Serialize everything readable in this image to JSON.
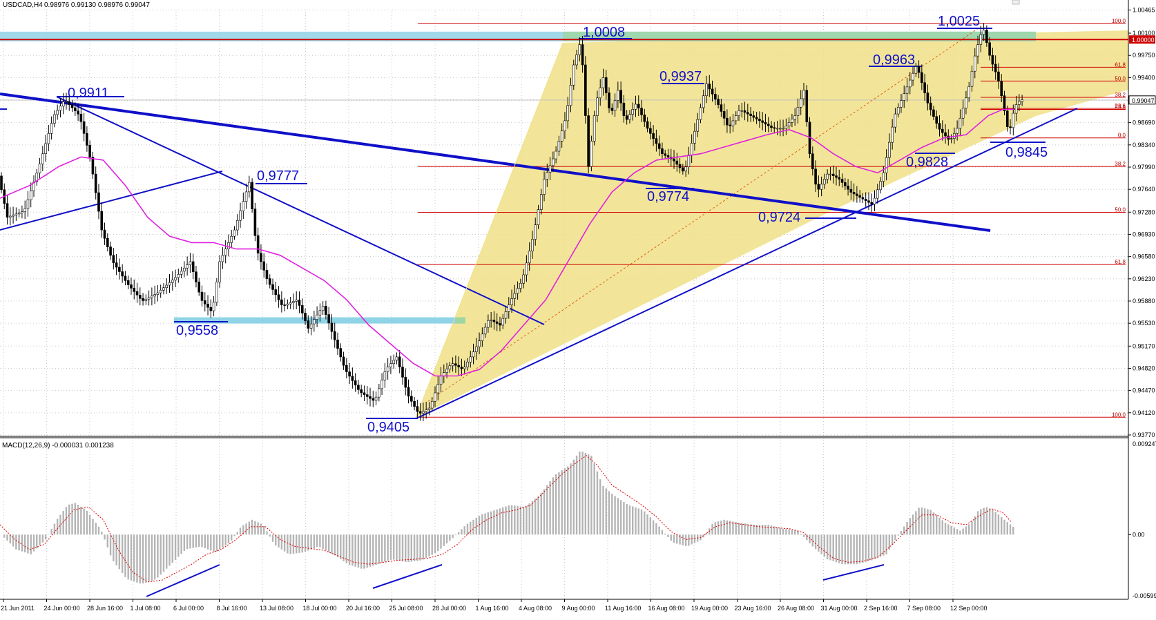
{
  "header": {
    "symbol": "USDCAD,H4",
    "ohlc": "0.98976 0.99130 0.98976 0.99047",
    "macd": "MACD(12,26,9) -0.000031 0.001238"
  },
  "chart_data": {
    "type": "candlestick",
    "title": "USDCAD,H4",
    "ylim": [
      0.9377,
      1.0047
    ],
    "price_ticks": [
      "1.00465",
      "1.00100",
      "0.99750",
      "0.99400",
      "0.99040",
      "0.98690",
      "0.98340",
      "0.97990",
      "0.97640",
      "0.97280",
      "0.96930",
      "0.96580",
      "0.96230",
      "0.95880",
      "0.95530",
      "0.95170",
      "0.94820",
      "0.94470",
      "0.94120",
      "0.93770"
    ],
    "price_label_current": "0.99047",
    "price_label_level": "1.00000",
    "time_labels": [
      "21 Jun 2011",
      "24 Jun 00:00",
      "28 Jun 16:00",
      "1 Jul 08:00",
      "6 Jul 00:00",
      "8 Jul 16:00",
      "13 Jul 08:00",
      "18 Jul 00:00",
      "20 Jul 16:00",
      "25 Jul 08:00",
      "28 Jul 00:00",
      "1 Aug 16:00",
      "4 Aug 08:00",
      "9 Aug 00:00",
      "11 Aug 16:00",
      "16 Aug 08:00",
      "19 Aug 00:00",
      "23 Aug 16:00",
      "26 Aug 08:00",
      "31 Aug 00:00",
      "2 Sep 16:00",
      "7 Sep 08:00",
      "12 Sep 00:00"
    ],
    "price_path": [
      [
        0,
        0.9785
      ],
      [
        12,
        0.972
      ],
      [
        35,
        0.973
      ],
      [
        55,
        0.98
      ],
      [
        75,
        0.988
      ],
      [
        90,
        0.9905
      ],
      [
        110,
        0.988
      ],
      [
        125,
        0.981
      ],
      [
        140,
        0.97
      ],
      [
        155,
        0.965
      ],
      [
        175,
        0.9615
      ],
      [
        195,
        0.9588
      ],
      [
        215,
        0.96
      ],
      [
        240,
        0.9625
      ],
      [
        260,
        0.965
      ],
      [
        275,
        0.959
      ],
      [
        290,
        0.957
      ],
      [
        300,
        0.965
      ],
      [
        320,
        0.97
      ],
      [
        340,
        0.9775
      ],
      [
        350,
        0.967
      ],
      [
        365,
        0.962
      ],
      [
        385,
        0.958
      ],
      [
        405,
        0.959
      ],
      [
        420,
        0.9545
      ],
      [
        440,
        0.958
      ],
      [
        455,
        0.953
      ],
      [
        470,
        0.948
      ],
      [
        490,
        0.9445
      ],
      [
        510,
        0.943
      ],
      [
        525,
        0.948
      ],
      [
        540,
        0.95
      ],
      [
        555,
        0.944
      ],
      [
        570,
        0.941
      ],
      [
        585,
        0.942
      ],
      [
        600,
        0.947
      ],
      [
        615,
        0.949
      ],
      [
        630,
        0.948
      ],
      [
        650,
        0.952
      ],
      [
        665,
        0.956
      ],
      [
        680,
        0.955
      ],
      [
        695,
        0.959
      ],
      [
        710,
        0.962
      ],
      [
        725,
        0.969
      ],
      [
        740,
        0.978
      ],
      [
        755,
        0.982
      ],
      [
        770,
        0.988
      ],
      [
        780,
        0.996
      ],
      [
        790,
        1.0
      ],
      [
        800,
        0.98
      ],
      [
        810,
        0.99
      ],
      [
        820,
        0.994
      ],
      [
        830,
        0.988
      ],
      [
        840,
        0.992
      ],
      [
        850,
        0.987
      ],
      [
        865,
        0.99
      ],
      [
        880,
        0.986
      ],
      [
        900,
        0.982
      ],
      [
        915,
        0.981
      ],
      [
        930,
        0.979
      ],
      [
        945,
        0.986
      ],
      [
        960,
        0.993
      ],
      [
        975,
        0.99
      ],
      [
        990,
        0.986
      ],
      [
        1005,
        0.989
      ],
      [
        1020,
        0.988
      ],
      [
        1035,
        0.987
      ],
      [
        1050,
        0.986
      ],
      [
        1065,
        0.986
      ],
      [
        1080,
        0.988
      ],
      [
        1092,
        0.992
      ],
      [
        1100,
        0.982
      ],
      [
        1110,
        0.976
      ],
      [
        1125,
        0.979
      ],
      [
        1140,
        0.978
      ],
      [
        1155,
        0.976
      ],
      [
        1170,
        0.975
      ],
      [
        1185,
        0.974
      ],
      [
        1200,
        0.979
      ],
      [
        1215,
        0.988
      ],
      [
        1230,
        0.992
      ],
      [
        1245,
        0.996
      ],
      [
        1260,
        0.99
      ],
      [
        1275,
        0.986
      ],
      [
        1290,
        0.984
      ],
      [
        1300,
        0.986
      ],
      [
        1315,
        0.992
      ],
      [
        1325,
        0.998
      ],
      [
        1335,
        1.002
      ],
      [
        1345,
        0.997
      ],
      [
        1355,
        0.994
      ],
      [
        1362,
        0.99
      ],
      [
        1370,
        0.985
      ],
      [
        1378,
        0.9895
      ],
      [
        1386,
        0.9905
      ]
    ],
    "ma_path": [
      [
        0,
        0.975
      ],
      [
        40,
        0.977
      ],
      [
        80,
        0.98
      ],
      [
        110,
        0.9815
      ],
      [
        140,
        0.981
      ],
      [
        170,
        0.977
      ],
      [
        200,
        0.972
      ],
      [
        230,
        0.969
      ],
      [
        260,
        0.968
      ],
      [
        290,
        0.968
      ],
      [
        320,
        0.967
      ],
      [
        350,
        0.967
      ],
      [
        380,
        0.966
      ],
      [
        410,
        0.964
      ],
      [
        440,
        0.962
      ],
      [
        470,
        0.959
      ],
      [
        500,
        0.955
      ],
      [
        530,
        0.952
      ],
      [
        560,
        0.949
      ],
      [
        590,
        0.947
      ],
      [
        620,
        0.947
      ],
      [
        650,
        0.948
      ],
      [
        680,
        0.951
      ],
      [
        710,
        0.955
      ],
      [
        740,
        0.959
      ],
      [
        770,
        0.965
      ],
      [
        800,
        0.971
      ],
      [
        830,
        0.976
      ],
      [
        860,
        0.979
      ],
      [
        890,
        0.981
      ],
      [
        920,
        0.9815
      ],
      [
        950,
        0.982
      ],
      [
        980,
        0.983
      ],
      [
        1010,
        0.984
      ],
      [
        1040,
        0.985
      ],
      [
        1070,
        0.9858
      ],
      [
        1100,
        0.9845
      ],
      [
        1130,
        0.982
      ],
      [
        1160,
        0.98
      ],
      [
        1190,
        0.979
      ],
      [
        1220,
        0.981
      ],
      [
        1250,
        0.983
      ],
      [
        1280,
        0.9845
      ],
      [
        1310,
        0.985
      ],
      [
        1340,
        0.988
      ],
      [
        1360,
        0.989
      ],
      [
        1375,
        0.989
      ]
    ],
    "annotations": [
      "0,9911",
      "0,9777",
      "0,9558",
      "0,9405",
      "1,0008",
      "0,9937",
      "0,9774",
      "0,9724",
      "0,9963",
      "1,0025",
      "0,9828",
      "0,9845"
    ],
    "fib_levels": [
      "100.0",
      "61.8",
      "50.0",
      "38.2",
      "23.6",
      "23.6",
      "0.0"
    ],
    "fib_levels_lower": [
      "38.2",
      "50.0",
      "61.8",
      "100.0"
    ],
    "macd_ticks": [
      "0.009247",
      "0.00",
      "-0.00599"
    ],
    "macd_hist": [
      [
        0,
        0.0
      ],
      [
        20,
        -0.0015
      ],
      [
        40,
        -0.002
      ],
      [
        60,
        -0.0005
      ],
      [
        75,
        0.0015
      ],
      [
        90,
        0.003
      ],
      [
        100,
        0.0032
      ],
      [
        115,
        0.0025
      ],
      [
        135,
        0.0005
      ],
      [
        150,
        -0.0025
      ],
      [
        170,
        -0.0045
      ],
      [
        190,
        -0.005
      ],
      [
        210,
        -0.0045
      ],
      [
        230,
        -0.003
      ],
      [
        250,
        -0.0015
      ],
      [
        270,
        -0.0012
      ],
      [
        290,
        -0.0018
      ],
      [
        310,
        -0.0008
      ],
      [
        325,
        0.0008
      ],
      [
        340,
        0.0015
      ],
      [
        355,
        0.001
      ],
      [
        370,
        -0.001
      ],
      [
        390,
        -0.002
      ],
      [
        410,
        -0.0018
      ],
      [
        430,
        -0.0012
      ],
      [
        450,
        -0.002
      ],
      [
        470,
        -0.003
      ],
      [
        490,
        -0.0035
      ],
      [
        510,
        -0.003
      ],
      [
        530,
        -0.0025
      ],
      [
        550,
        -0.0028
      ],
      [
        570,
        -0.0026
      ],
      [
        590,
        -0.0018
      ],
      [
        610,
        -0.0005
      ],
      [
        630,
        0.001
      ],
      [
        650,
        0.002
      ],
      [
        670,
        0.0025
      ],
      [
        690,
        0.003
      ],
      [
        710,
        0.0028
      ],
      [
        730,
        0.004
      ],
      [
        750,
        0.006
      ],
      [
        770,
        0.007
      ],
      [
        785,
        0.0085
      ],
      [
        800,
        0.008
      ],
      [
        815,
        0.005
      ],
      [
        830,
        0.004
      ],
      [
        850,
        0.003
      ],
      [
        870,
        0.0025
      ],
      [
        890,
        0.001
      ],
      [
        910,
        -0.0008
      ],
      [
        930,
        -0.0012
      ],
      [
        950,
        -0.0005
      ],
      [
        965,
        0.0012
      ],
      [
        980,
        0.0015
      ],
      [
        1000,
        0.0012
      ],
      [
        1020,
        0.001
      ],
      [
        1040,
        0.001
      ],
      [
        1060,
        0.0006
      ],
      [
        1080,
        0.0004
      ],
      [
        1100,
        -0.0012
      ],
      [
        1120,
        -0.0025
      ],
      [
        1140,
        -0.003
      ],
      [
        1160,
        -0.003
      ],
      [
        1180,
        -0.0026
      ],
      [
        1200,
        -0.002
      ],
      [
        1215,
        -0.0002
      ],
      [
        1230,
        0.0015
      ],
      [
        1245,
        0.0028
      ],
      [
        1260,
        0.0025
      ],
      [
        1280,
        0.0012
      ],
      [
        1300,
        0.0004
      ],
      [
        1315,
        0.0012
      ],
      [
        1325,
        0.0025
      ],
      [
        1335,
        0.0028
      ],
      [
        1345,
        0.0025
      ],
      [
        1360,
        0.0015
      ],
      [
        1372,
        0.0008
      ]
    ],
    "macd_signal": [
      [
        0,
        0.001
      ],
      [
        20,
        -0.0005
      ],
      [
        40,
        -0.0015
      ],
      [
        60,
        -0.001
      ],
      [
        80,
        0.0008
      ],
      [
        100,
        0.0025
      ],
      [
        120,
        0.0028
      ],
      [
        140,
        0.0015
      ],
      [
        160,
        -0.0015
      ],
      [
        180,
        -0.0038
      ],
      [
        200,
        -0.0048
      ],
      [
        220,
        -0.0046
      ],
      [
        240,
        -0.0038
      ],
      [
        260,
        -0.003
      ],
      [
        280,
        -0.002
      ],
      [
        300,
        -0.0015
      ],
      [
        320,
        -0.0005
      ],
      [
        340,
        0.0008
      ],
      [
        360,
        0.0008
      ],
      [
        380,
        -0.0005
      ],
      [
        400,
        -0.0012
      ],
      [
        420,
        -0.0014
      ],
      [
        440,
        -0.0016
      ],
      [
        460,
        -0.0022
      ],
      [
        480,
        -0.0028
      ],
      [
        500,
        -0.003
      ],
      [
        520,
        -0.0028
      ],
      [
        540,
        -0.0026
      ],
      [
        560,
        -0.0025
      ],
      [
        580,
        -0.0024
      ],
      [
        600,
        -0.002
      ],
      [
        620,
        -0.001
      ],
      [
        640,
        0.0005
      ],
      [
        660,
        0.0015
      ],
      [
        680,
        0.0022
      ],
      [
        700,
        0.0025
      ],
      [
        720,
        0.003
      ],
      [
        740,
        0.0045
      ],
      [
        760,
        0.006
      ],
      [
        780,
        0.0072
      ],
      [
        795,
        0.008
      ],
      [
        810,
        0.007
      ],
      [
        830,
        0.005
      ],
      [
        850,
        0.004
      ],
      [
        870,
        0.003
      ],
      [
        890,
        0.0018
      ],
      [
        910,
        0.0003
      ],
      [
        930,
        -0.0005
      ],
      [
        950,
        -0.0003
      ],
      [
        970,
        0.0008
      ],
      [
        990,
        0.0012
      ],
      [
        1010,
        0.001
      ],
      [
        1030,
        0.0008
      ],
      [
        1050,
        0.0007
      ],
      [
        1070,
        0.0006
      ],
      [
        1090,
        0.0002
      ],
      [
        1110,
        -0.0012
      ],
      [
        1130,
        -0.0024
      ],
      [
        1150,
        -0.0028
      ],
      [
        1170,
        -0.0027
      ],
      [
        1190,
        -0.0023
      ],
      [
        1210,
        -0.001
      ],
      [
        1230,
        0.0005
      ],
      [
        1250,
        0.002
      ],
      [
        1270,
        0.002
      ],
      [
        1290,
        0.0012
      ],
      [
        1310,
        0.001
      ],
      [
        1330,
        0.002
      ],
      [
        1345,
        0.0026
      ],
      [
        1360,
        0.0022
      ],
      [
        1372,
        0.0012
      ]
    ]
  }
}
